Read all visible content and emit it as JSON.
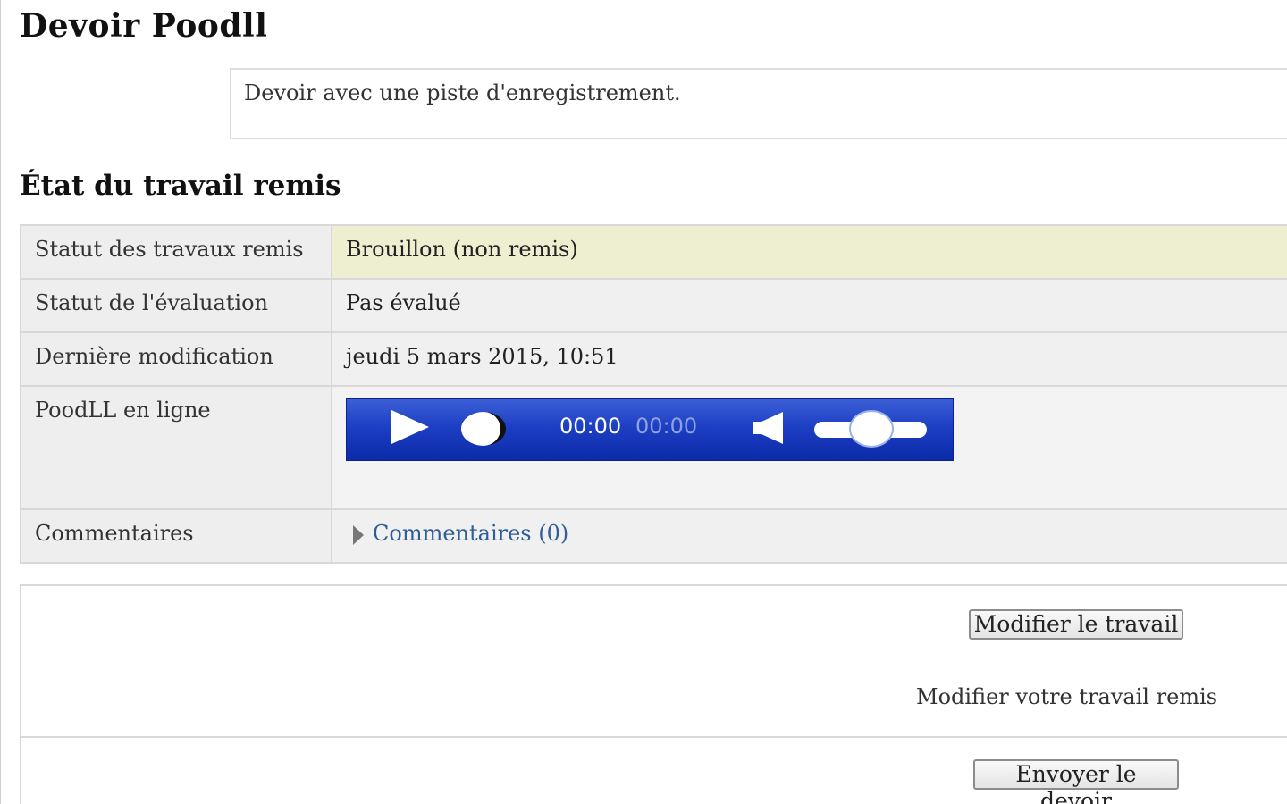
{
  "page": {
    "title": "Devoir Poodll",
    "intro": "Devoir avec une piste d'enregistrement."
  },
  "submission_status": {
    "heading": "État du travail remis",
    "rows": [
      {
        "label": "Statut des travaux remis",
        "value": "Brouillon (non remis)"
      },
      {
        "label": "Statut de l'évaluation",
        "value": "Pas évalué"
      },
      {
        "label": "Dernière modification",
        "value": "jeudi 5 mars 2015, 10:51"
      },
      {
        "label": "PoodLL en ligne"
      },
      {
        "label": "Commentaires",
        "value": "Commentaires (0)"
      }
    ]
  },
  "player": {
    "time_current": "00:00",
    "time_total": "00:00",
    "seek_position": 0,
    "volume_level": 0.5,
    "icons": [
      "play-icon",
      "seek-knob",
      "speaker-icon",
      "volume-slider"
    ]
  },
  "actions": {
    "edit_button": "Modifier le travail",
    "edit_description": "Modifier votre travail remis",
    "submit_button": "Envoyer le devoir"
  },
  "colors": {
    "status_highlight": "#eeeed1",
    "player_blue": "#1d3fc4",
    "link": "#2f5d94"
  }
}
